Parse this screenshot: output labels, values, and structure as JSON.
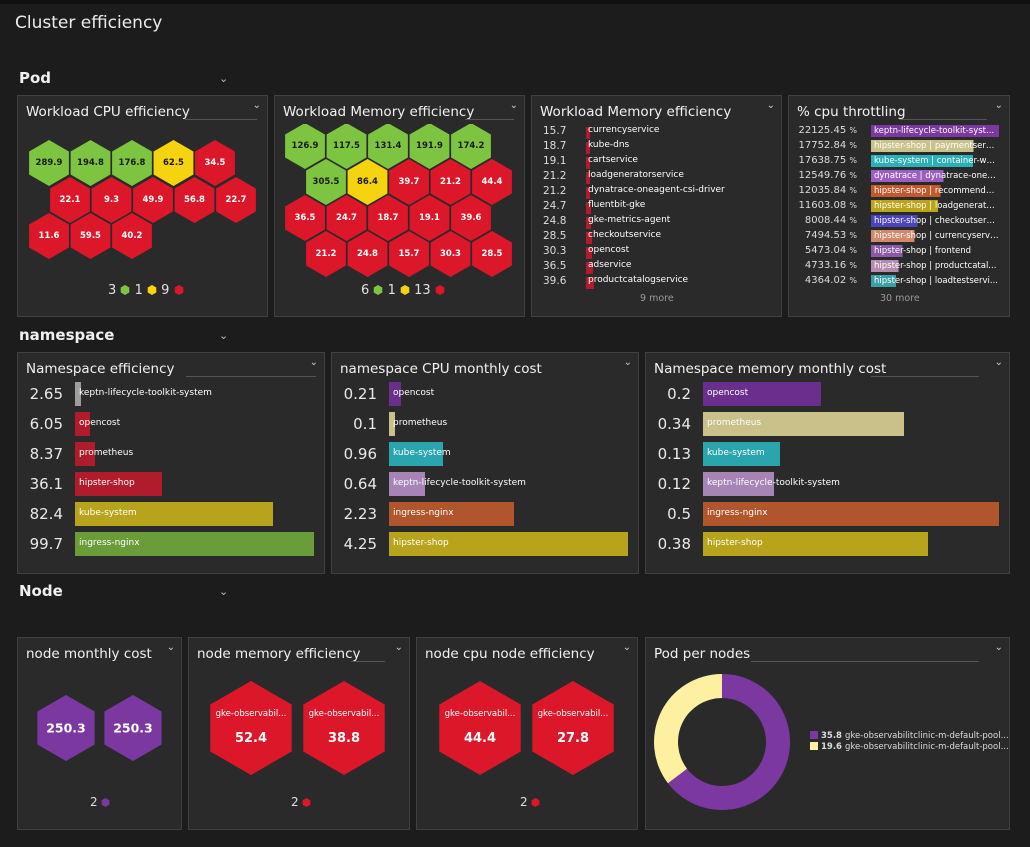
{
  "page_title": "Cluster efficiency",
  "sections": {
    "pod": "Pod",
    "namespace": "namespace",
    "node": "Node"
  },
  "colors": {
    "green": "#7dc540",
    "yellow": "#f5d30f",
    "red": "#dc172a",
    "purple": "#7c38a1"
  },
  "tiles": {
    "workload_cpu": {
      "title": "Workload CPU efficiency",
      "hexes": [
        {
          "v": "289.9",
          "s": "g"
        },
        {
          "v": "194.8",
          "s": "g"
        },
        {
          "v": "176.8",
          "s": "g"
        },
        {
          "v": "62.5",
          "s": "y"
        },
        {
          "v": "34.5",
          "s": "r"
        },
        {
          "v": "22.1",
          "s": "r"
        },
        {
          "v": "9.3",
          "s": "r"
        },
        {
          "v": "49.9",
          "s": "r"
        },
        {
          "v": "56.8",
          "s": "r"
        },
        {
          "v": "22.7",
          "s": "r"
        },
        {
          "v": "11.6",
          "s": "r"
        },
        {
          "v": "59.5",
          "s": "r"
        },
        {
          "v": "40.2",
          "s": "r"
        }
      ],
      "counts": {
        "green": "3",
        "yellow": "1",
        "red": "9"
      }
    },
    "workload_memory_hex": {
      "title": "Workload Memory efficiency",
      "hexes": [
        {
          "v": "126.9",
          "s": "g"
        },
        {
          "v": "117.5",
          "s": "g"
        },
        {
          "v": "131.4",
          "s": "g"
        },
        {
          "v": "191.9",
          "s": "g"
        },
        {
          "v": "174.2",
          "s": "g"
        },
        {
          "v": "305.5",
          "s": "g"
        },
        {
          "v": "86.4",
          "s": "y"
        },
        {
          "v": "39.7",
          "s": "r"
        },
        {
          "v": "21.2",
          "s": "r"
        },
        {
          "v": "44.4",
          "s": "r"
        },
        {
          "v": "36.5",
          "s": "r"
        },
        {
          "v": "24.7",
          "s": "r"
        },
        {
          "v": "18.7",
          "s": "r"
        },
        {
          "v": "19.1",
          "s": "r"
        },
        {
          "v": "39.6",
          "s": "r"
        },
        {
          "v": "21.2",
          "s": "r"
        },
        {
          "v": "24.8",
          "s": "r"
        },
        {
          "v": "15.7",
          "s": "r"
        },
        {
          "v": "30.3",
          "s": "r"
        },
        {
          "v": "28.5",
          "s": "r"
        }
      ],
      "counts": {
        "green": "6",
        "yellow": "1",
        "red": "13"
      }
    },
    "workload_memory_list": {
      "title": "Workload Memory efficiency",
      "rows": [
        {
          "v": "15.7",
          "l": "currencyservice"
        },
        {
          "v": "18.7",
          "l": "kube-dns"
        },
        {
          "v": "19.1",
          "l": "cartservice"
        },
        {
          "v": "21.2",
          "l": "loadgeneratorservice"
        },
        {
          "v": "21.2",
          "l": "dynatrace-oneagent-csi-driver"
        },
        {
          "v": "24.7",
          "l": "fluentbit-gke"
        },
        {
          "v": "24.8",
          "l": "gke-metrics-agent"
        },
        {
          "v": "28.5",
          "l": "checkoutservice"
        },
        {
          "v": "30.3",
          "l": "opencost"
        },
        {
          "v": "36.5",
          "l": "adservice"
        },
        {
          "v": "39.6",
          "l": "productcatalogservice"
        }
      ],
      "more": "9 more"
    },
    "cpu_throttling": {
      "title": "% cpu throttling",
      "unit": "%",
      "rows": [
        {
          "v": "22125.45",
          "l": "keptn-lifecycle-toolkit-syst...",
          "c": "#7c38a1"
        },
        {
          "v": "17752.84",
          "l": "hipster-shop | paymentservi...",
          "c": "#c9c28a"
        },
        {
          "v": "17638.75",
          "l": "kube-system | container-wa...",
          "c": "#2ab0b6"
        },
        {
          "v": "12549.76",
          "l": "dynatrace | dynatrace-onea...",
          "c": "#9b5fc0"
        },
        {
          "v": "12035.84",
          "l": "hipster-shop | recommenda...",
          "c": "#c05a2c"
        },
        {
          "v": "11603.08",
          "l": "hipster-shop | loadgenerato...",
          "c": "#b9a41a"
        },
        {
          "v": "8008.44",
          "l": "hipster-shop | checkoutservi...",
          "c": "#4a44b8"
        },
        {
          "v": "7494.53",
          "l": "hipster-shop | currencyservice",
          "c": "#d0896a"
        },
        {
          "v": "5473.04",
          "l": "hipster-shop | frontend",
          "c": "#8a5aa8"
        },
        {
          "v": "4733.16",
          "l": "hipster-shop | productcatal...",
          "c": "#b58bb0"
        },
        {
          "v": "4364.02",
          "l": "hipster-shop | loadtestservi...",
          "c": "#3aa0a8"
        }
      ],
      "more": "30 more"
    },
    "namespace_efficiency": {
      "title": "Namespace efficiency",
      "rows": [
        {
          "v": "2.65",
          "l": "keptn-lifecycle-toolkit-system",
          "n": 2.65,
          "c": "#9e9e9e"
        },
        {
          "v": "6.05",
          "l": "opencost",
          "n": 6.05,
          "c": "#b01c2c"
        },
        {
          "v": "8.37",
          "l": "prometheus",
          "n": 8.37,
          "c": "#b01c2c"
        },
        {
          "v": "36.1",
          "l": "hipster-shop",
          "n": 36.1,
          "c": "#b01c2c"
        },
        {
          "v": "82.4",
          "l": "kube-system",
          "n": 82.4,
          "c": "#b8a41c"
        },
        {
          "v": "99.7",
          "l": "ingress-nginx",
          "n": 99.7,
          "c": "#6b9c3a"
        }
      ]
    },
    "namespace_cpu_cost": {
      "title": "namespace CPU monthly cost",
      "rows": [
        {
          "v": "0.21",
          "l": "opencost",
          "n": 0.21,
          "c": "#6a2f8c"
        },
        {
          "v": "0.1",
          "l": "prometheus",
          "n": 0.1,
          "c": "#c9c08a"
        },
        {
          "v": "0.96",
          "l": "kube-system",
          "n": 0.96,
          "c": "#2aa4ad"
        },
        {
          "v": "0.64",
          "l": "keptn-lifecycle-toolkit-system",
          "n": 0.64,
          "c": "#a684b5"
        },
        {
          "v": "2.23",
          "l": "ingress-nginx",
          "n": 2.23,
          "c": "#b0552c"
        },
        {
          "v": "4.25",
          "l": "hipster-shop",
          "n": 4.25,
          "c": "#b8a41c"
        }
      ]
    },
    "namespace_memory_cost": {
      "title": "Namespace memory monthly cost",
      "rows": [
        {
          "v": "0.2",
          "l": "opencost",
          "n": 0.2,
          "c": "#6a2f8c"
        },
        {
          "v": "0.34",
          "l": "prometheus",
          "n": 0.34,
          "c": "#c9c08a"
        },
        {
          "v": "0.13",
          "l": "kube-system",
          "n": 0.13,
          "c": "#2aa4ad"
        },
        {
          "v": "0.12",
          "l": "keptn-lifecycle-toolkit-system",
          "n": 0.12,
          "c": "#a684b5"
        },
        {
          "v": "0.5",
          "l": "ingress-nginx",
          "n": 0.5,
          "c": "#b0552c"
        },
        {
          "v": "0.38",
          "l": "hipster-shop",
          "n": 0.38,
          "c": "#b8a41c"
        }
      ]
    },
    "node_monthly_cost": {
      "title": "node monthly cost",
      "hexes": [
        {
          "v": "250.3"
        },
        {
          "v": "250.3"
        }
      ],
      "count": "2"
    },
    "node_memory_eff": {
      "title": "node memory efficiency",
      "hexes": [
        {
          "n": "gke-observabil...",
          "v": "52.4"
        },
        {
          "n": "gke-observabil...",
          "v": "38.8"
        }
      ],
      "count": "2"
    },
    "node_cpu_eff": {
      "title": "node cpu node efficiency",
      "hexes": [
        {
          "n": "gke-observabil...",
          "v": "44.4"
        },
        {
          "n": "gke-observabil...",
          "v": "27.8"
        }
      ],
      "count": "2"
    },
    "pod_per_nodes": {
      "title": "Pod per nodes",
      "legend": [
        {
          "v": "35.8",
          "l": "gke-observabilitclinic-m-default-pool...",
          "c": "#7c38a1"
        },
        {
          "v": "19.6",
          "l": "gke-observabilitclinic-m-default-pool...",
          "c": "#fdf0a0"
        }
      ]
    }
  },
  "chart_data": [
    {
      "type": "pie",
      "title": "Pod per nodes",
      "categories": [
        "gke-observabilitclinic-m-default-pool...",
        "gke-observabilitclinic-m-default-pool..."
      ],
      "values": [
        35.8,
        19.6
      ]
    }
  ]
}
